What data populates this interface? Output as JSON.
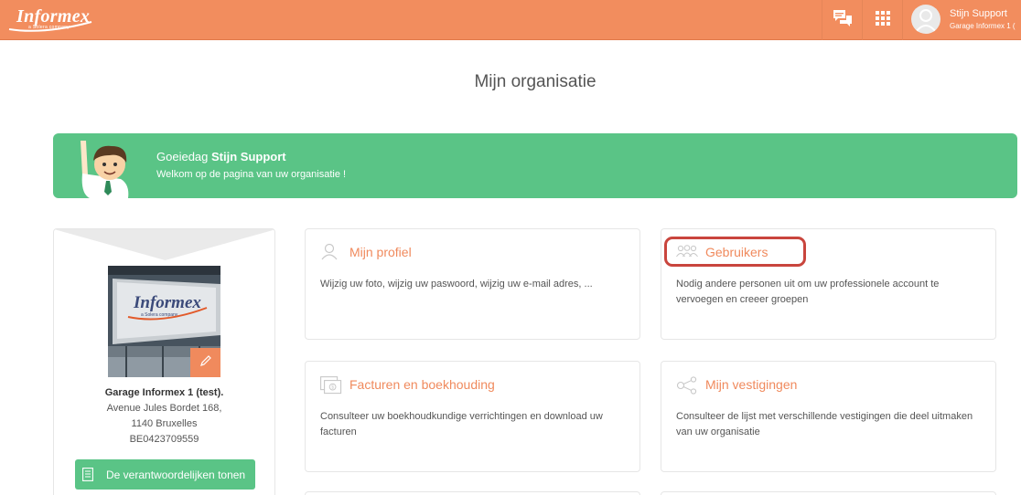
{
  "topbar": {
    "logo_text": "Informex",
    "logo_sub": "a Solera company",
    "user_name": "Stijn Support",
    "user_org": "Garage Informex 1 (",
    "icons": [
      "chat-icon",
      "apps-grid-icon",
      "user-avatar-icon"
    ]
  },
  "page": {
    "title": "Mijn organisatie"
  },
  "banner": {
    "greeting_prefix": "Goeiedag",
    "greeting_name": "Stijn Support",
    "welcome": "Welkom op de pagina van uw organisatie !"
  },
  "organization": {
    "photo_sign": "Informex",
    "photo_sign_sub": "a Solera company",
    "name": "Garage Informex 1 (test).",
    "street": "Avenue Jules Bordet 168,",
    "city": "1140 Bruxelles",
    "vat": "BE0423709559",
    "responsible_button": "De verantwoordelijken tonen"
  },
  "cards": [
    {
      "title": "Mijn profiel",
      "desc": "Wijzig uw foto, wijzig uw paswoord, wijzig uw e-mail adres, ...",
      "icon": "profile-icon"
    },
    {
      "title": "Gebruikers",
      "desc": "Nodig andere personen uit om uw professionele account te vervoegen en creeer groepen",
      "icon": "users-icon"
    },
    {
      "title": "Facturen en boekhouding",
      "desc": "Consulteer uw boekhoudkundige verrichtingen en download uw facturen",
      "icon": "invoice-icon"
    },
    {
      "title": "Mijn vestigingen",
      "desc": "Consulteer de lijst met verschillende vestigingen die deel uitmaken van uw organisatie",
      "icon": "branches-icon"
    }
  ],
  "colors": {
    "topbar": "#f28d5e",
    "accent": "#f08a5d",
    "green": "#5ac486",
    "highlight": "#c9453d"
  }
}
